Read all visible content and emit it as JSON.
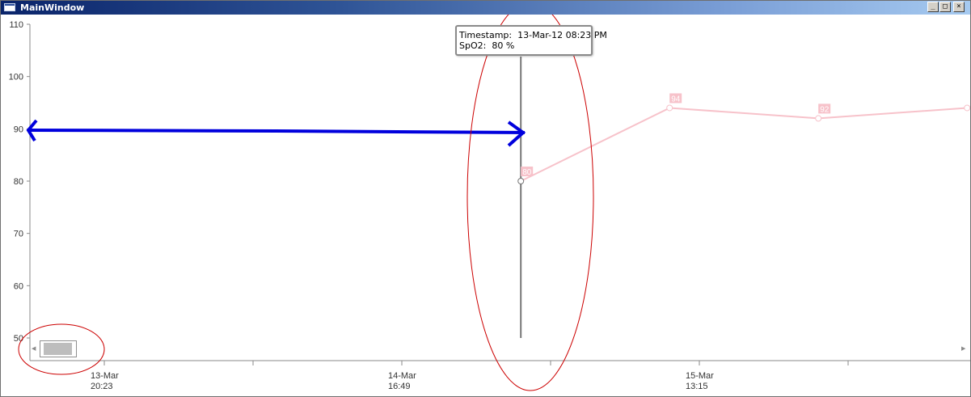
{
  "window": {
    "title": "MainWindow",
    "minimize_glyph": "_",
    "maximize_glyph": "□",
    "close_glyph": "×"
  },
  "chart_data": {
    "type": "line",
    "title": "",
    "xlabel": "",
    "ylabel": "",
    "ylim": [
      50,
      110
    ],
    "yticks": [
      "50",
      "60",
      "70",
      "80",
      "90",
      "100",
      "110"
    ],
    "xticks": [
      {
        "line1": "13-Mar",
        "line2": "20:23",
        "t": 0
      },
      {
        "line1": "14-Mar",
        "line2": "16:49",
        "t": 1
      },
      {
        "line1": "15-Mar",
        "line2": "13:15",
        "t": 2
      }
    ],
    "series": [
      {
        "color": "#f7c2ca",
        "points": [
          {
            "t": 1.4,
            "y": 80,
            "label": "80"
          },
          {
            "t": 1.9,
            "y": 94,
            "label": "94"
          },
          {
            "t": 2.4,
            "y": 92,
            "label": "92"
          },
          {
            "t": 2.9,
            "y": 94,
            "label": ""
          }
        ]
      }
    ],
    "grid": false
  },
  "tooltip": {
    "line1": "Timestamp:  13-Mar-12 08:23 PM",
    "line2": "SpO2:  80 %"
  },
  "colors": {
    "annotation_arrow": "#0000dd",
    "annotation_ellipse": "#cc0000",
    "cursor_line": "#777777"
  }
}
